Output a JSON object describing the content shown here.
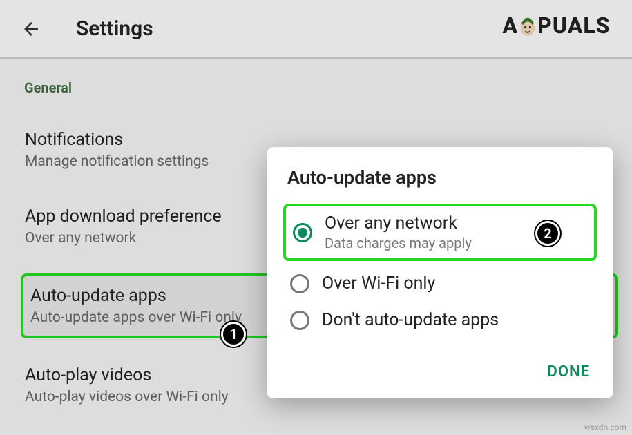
{
  "header": {
    "title": "Settings",
    "logo_text_left": "A",
    "logo_text_right": "PUALS"
  },
  "section_header": "General",
  "settings": {
    "notifications": {
      "title": "Notifications",
      "sub": "Manage notification settings"
    },
    "download": {
      "title": "App download preference",
      "sub": "Over any network"
    },
    "autoupdate": {
      "title": "Auto-update apps",
      "sub": "Auto-update apps over Wi-Fi only"
    },
    "autoplay": {
      "title": "Auto-play videos",
      "sub": "Auto-play videos over Wi-Fi only"
    }
  },
  "dialog": {
    "title": "Auto-update apps",
    "options": {
      "any": {
        "label": "Over any network",
        "sub": "Data charges may apply"
      },
      "wifi": {
        "label": "Over Wi-Fi only"
      },
      "none": {
        "label": "Don't auto-update apps"
      }
    },
    "done": "DONE"
  },
  "badges": {
    "one": "1",
    "two": "2"
  },
  "watermark": "wsxdn.com"
}
